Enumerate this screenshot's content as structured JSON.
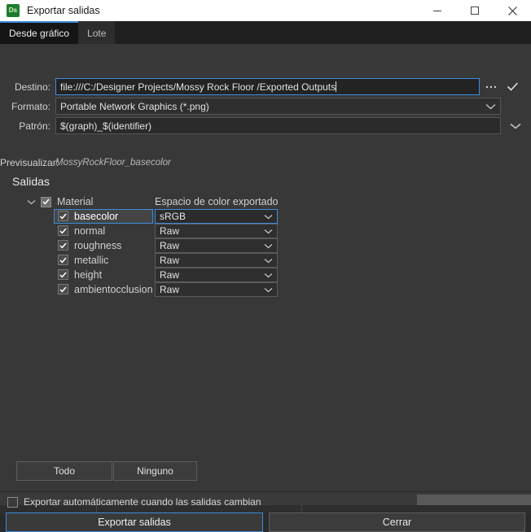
{
  "window": {
    "title": "Exportar salidas",
    "app_icon_text": "Ds",
    "minimize_label": "Minimizar",
    "maximize_label": "Maximizar",
    "close_label": "Cerrar"
  },
  "tabs": [
    {
      "label": "Desde gráfico",
      "active": true
    },
    {
      "label": "Lote",
      "active": false
    }
  ],
  "form": {
    "destination": {
      "label": "Destino:",
      "value": "file:///C:/Designer Projects/Mossy Rock Floor /Exported Outputs",
      "placeholder": "file:///",
      "browse_label": "...",
      "confirm_label": "✓"
    },
    "format": {
      "label": "Formato:",
      "value": "Portable Network Graphics (*.png)",
      "options": [
        "Portable Network Graphics (*.png)"
      ]
    },
    "pattern": {
      "label": "Patrón:",
      "value": "$(graph)_$(identifier)",
      "placeholder": "$(graph)_$(identifier)",
      "options": [
        "$(graph)_$(identifier)"
      ]
    },
    "preview": {
      "label": "Previsualizar:",
      "value": "MossyRockFloor_basecolor"
    }
  },
  "outputs": {
    "heading": "Salidas",
    "group": {
      "name": "Material",
      "checked": true,
      "expanded": true
    },
    "colorspace_column_header": "Espacio de color exportado",
    "rows": [
      {
        "name": "basecolor",
        "checked": true,
        "colorspace": "sRGB",
        "selected": true
      },
      {
        "name": "normal",
        "checked": true,
        "colorspace": "Raw",
        "selected": false
      },
      {
        "name": "roughness",
        "checked": true,
        "colorspace": "Raw",
        "selected": false
      },
      {
        "name": "metallic",
        "checked": true,
        "colorspace": "Raw",
        "selected": false
      },
      {
        "name": "height",
        "checked": true,
        "colorspace": "Raw",
        "selected": false
      },
      {
        "name": "ambientocclusion",
        "checked": true,
        "colorspace": "Raw",
        "selected": false
      }
    ],
    "colorspace_options": [
      "sRGB",
      "Raw"
    ]
  },
  "selection_buttons": {
    "all_label": "Todo",
    "none_label": "Ninguno"
  },
  "auto_export": {
    "label": "Exportar automáticamente cuando las salidas cambian",
    "checked": false
  },
  "actions": {
    "export_label": "Exportar salidas",
    "close_label": "Cerrar"
  },
  "colors": {
    "accent": "#3d8bdc",
    "dialog_bg": "#383838",
    "titlebar_bg": "#ffffff",
    "tabbar_bg": "#1f1f1f",
    "active_tab_bg": "#151515",
    "app_icon_green": "#1d7d2f"
  }
}
